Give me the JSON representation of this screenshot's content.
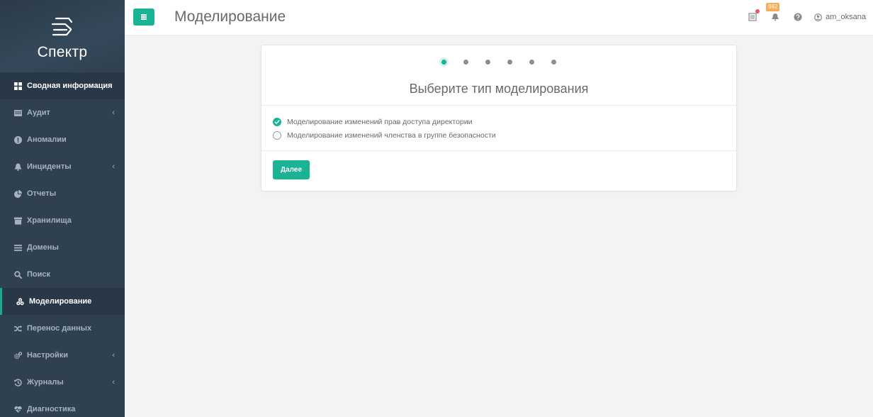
{
  "brand": {
    "name": "Спектр"
  },
  "topbar": {
    "title": "Моделирование",
    "notification_count": "982",
    "username": "am_oksana"
  },
  "sidebar": {
    "items": [
      {
        "label": "Сводная информация",
        "icon": "grid-icon",
        "has_submenu": false
      },
      {
        "label": "Аудит",
        "icon": "list-icon",
        "has_submenu": true
      },
      {
        "label": "Аномалии",
        "icon": "exclamation-circle-icon",
        "has_submenu": false
      },
      {
        "label": "Инциденты",
        "icon": "bell-icon",
        "has_submenu": true
      },
      {
        "label": "Отчеты",
        "icon": "pie-chart-icon",
        "has_submenu": false
      },
      {
        "label": "Хранилища",
        "icon": "archive-icon",
        "has_submenu": false
      },
      {
        "label": "Домены",
        "icon": "bars-icon",
        "has_submenu": false
      },
      {
        "label": "Поиск",
        "icon": "search-icon",
        "has_submenu": false
      },
      {
        "label": "Моделирование",
        "icon": "cubes-icon",
        "has_submenu": false
      },
      {
        "label": "Перенос данных",
        "icon": "shuffle-icon",
        "has_submenu": false
      },
      {
        "label": "Настройки",
        "icon": "gears-icon",
        "has_submenu": true
      },
      {
        "label": "Журналы",
        "icon": "history-icon",
        "has_submenu": true
      },
      {
        "label": "Диагностика",
        "icon": "heartbeat-icon",
        "has_submenu": false
      }
    ],
    "chevron": "‹"
  },
  "wizard": {
    "steps_total": 6,
    "current_step": 1,
    "title": "Выберите тип моделирования",
    "options": [
      {
        "label": "Моделирование изменений прав доступа директории",
        "selected": true
      },
      {
        "label": "Моделирование изменений членства в группе безопасности",
        "selected": false
      }
    ],
    "next_label": "Далее"
  },
  "colors": {
    "accent": "#1ab394",
    "sidebar_bg": "#2f4050",
    "badge": "#f8ac59",
    "alert": "#ed5565"
  }
}
